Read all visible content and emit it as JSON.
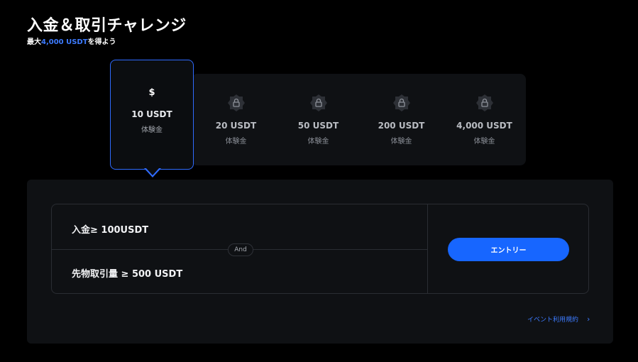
{
  "header": {
    "title": "入金＆取引チャレンジ",
    "subtitle_prefix": "最大",
    "subtitle_highlight": "4,000 USDT",
    "subtitle_suffix": "を得よう"
  },
  "tiers": [
    {
      "amount": "10 USDT",
      "label": "体験金",
      "icon": "dollar-icon",
      "symbol": "$",
      "active": true
    },
    {
      "amount": "20 USDT",
      "label": "体験金",
      "icon": "lock-icon",
      "active": false
    },
    {
      "amount": "50 USDT",
      "label": "体験金",
      "icon": "lock-icon",
      "active": false
    },
    {
      "amount": "200 USDT",
      "label": "体験金",
      "icon": "lock-icon",
      "active": false
    },
    {
      "amount": "4,000 USDT",
      "label": "体験金",
      "icon": "lock-icon",
      "active": false
    }
  ],
  "conditions": {
    "deposit": "入金≥ 100USDT",
    "connector": "And",
    "trade": "先物取引量 ≥ 500 USDT"
  },
  "entry_button": "エントリー",
  "terms_link": {
    "label": "イベント利用規約",
    "chevron": "›"
  },
  "colors": {
    "accent": "#1766ff",
    "highlight": "#3d7bff",
    "panel": "#0f1114"
  }
}
